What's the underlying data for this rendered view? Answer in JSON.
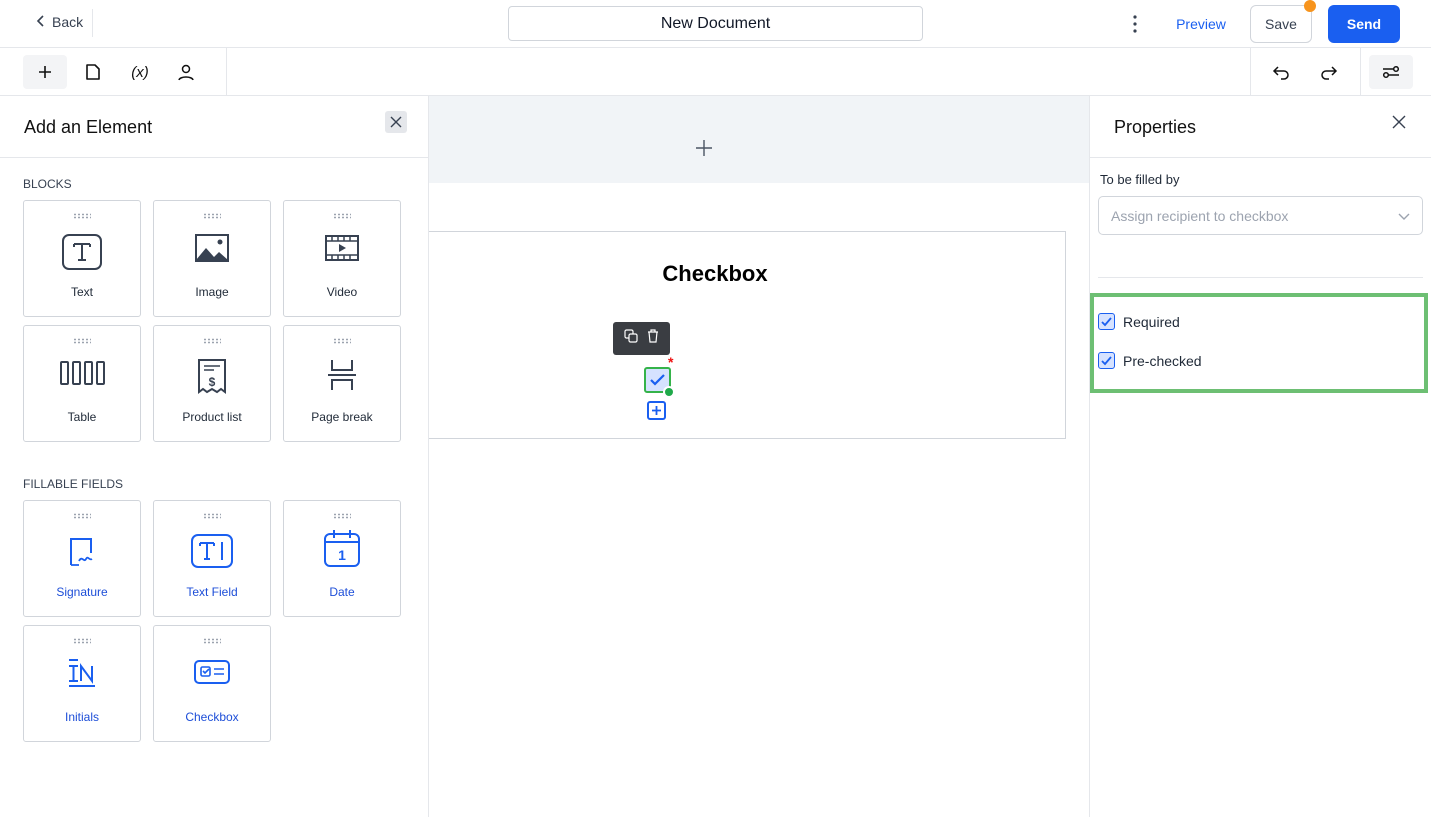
{
  "header": {
    "back_label": "Back",
    "document_title": "New Document",
    "preview_label": "Preview",
    "save_label": "Save",
    "send_label": "Send"
  },
  "colors": {
    "accent": "#1a5ff0",
    "unsaved_dot": "#f59e0b",
    "highlight": "#6dbf73"
  },
  "toolbar": {
    "left_icons": [
      "plus-icon",
      "document-icon",
      "variable-icon",
      "user-icon"
    ],
    "right_icons": [
      "undo-icon",
      "redo-icon",
      "settings-sliders-icon"
    ]
  },
  "left_panel": {
    "title": "Add an Element",
    "blocks_heading": "BLOCKS",
    "blocks": [
      {
        "label": "Text"
      },
      {
        "label": "Image"
      },
      {
        "label": "Video"
      },
      {
        "label": "Table"
      },
      {
        "label": "Product list"
      },
      {
        "label": "Page break"
      }
    ],
    "fillable_heading": "FILLABLE FIELDS",
    "fillable": [
      {
        "label": "Signature"
      },
      {
        "label": "Text Field"
      },
      {
        "label": "Date"
      },
      {
        "label": "Initials"
      },
      {
        "label": "Checkbox"
      }
    ]
  },
  "canvas": {
    "block_title": "Checkbox",
    "checkbox_checked": true,
    "required_marker": "*"
  },
  "properties": {
    "title": "Properties",
    "filled_by_label": "To be filled by",
    "recipient_placeholder": "Assign recipient to checkbox",
    "options": [
      {
        "label": "Required",
        "checked": true
      },
      {
        "label": "Pre-checked",
        "checked": true
      }
    ]
  }
}
